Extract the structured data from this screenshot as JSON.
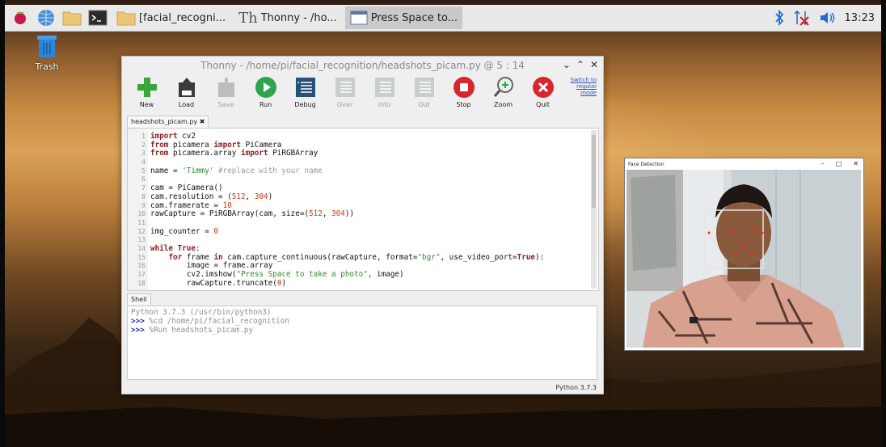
{
  "taskbar": {
    "tasks": [
      {
        "label": "[facial_recogni...",
        "icon": "folder-icon"
      },
      {
        "label": "Thonny  -  /ho...",
        "icon": "thonny-icon"
      },
      {
        "label": "Press Space to...",
        "icon": "window-icon"
      }
    ],
    "clock": "13:23",
    "icons": [
      "raspberry-menu-icon",
      "browser-icon",
      "file-manager-icon",
      "terminal-icon",
      "bluetooth-icon",
      "network-icon",
      "volume-icon"
    ]
  },
  "desktop": {
    "trash_label": "Trash"
  },
  "thonny": {
    "title": "Thonny  -  /home/pi/facial_recognition/headshots_picam.py  @  5 : 14",
    "toolbar": [
      {
        "label": "New",
        "enabled": true
      },
      {
        "label": "Load",
        "enabled": true
      },
      {
        "label": "Save",
        "enabled": false
      },
      {
        "label": "Run",
        "enabled": true
      },
      {
        "label": "Debug",
        "enabled": true
      },
      {
        "label": "Over",
        "enabled": false
      },
      {
        "label": "Into",
        "enabled": false
      },
      {
        "label": "Out",
        "enabled": false
      },
      {
        "label": "Stop",
        "enabled": true
      },
      {
        "label": "Zoom",
        "enabled": true
      },
      {
        "label": "Quit",
        "enabled": true
      }
    ],
    "switch_mode": "Switch to regular mode",
    "editor_tab": "headshots_picam.py ✖",
    "code_lines": [
      "import cv2",
      "from picamera import PiCamera",
      "from picamera.array import PiRGBArray",
      "",
      "name = 'Timmy' #replace with your name",
      "",
      "cam = PiCamera()",
      "cam.resolution = (512, 304)",
      "cam.framerate = 10",
      "rawCapture = PiRGBArray(cam, size=(512, 304))",
      "",
      "img_counter = 0",
      "",
      "while True:",
      "    for frame in cam.capture_continuous(rawCapture, format=\"bgr\", use_video_port=True):",
      "        image = frame.array",
      "        cv2.imshow(\"Press Space to take a photo\", image)",
      "        rawCapture.truncate(0)"
    ],
    "shell_tab": "Shell",
    "shell_lines": [
      {
        "prompt": "",
        "text": "Python 3.7.3 (/usr/bin/python3)"
      },
      {
        "prompt": ">>>",
        "text": " %cd /home/pi/facial_recognition"
      },
      {
        "prompt": ">>>",
        "text": " %Run headshots_picam.py"
      }
    ],
    "status": "Python 3.7.3"
  },
  "face_window": {
    "title": "Face Detection"
  },
  "colors": {
    "accent_blue": "#2a55c8",
    "keyword": "#8b1c1c",
    "string": "#2e8b2e",
    "number": "#c23a1a"
  }
}
